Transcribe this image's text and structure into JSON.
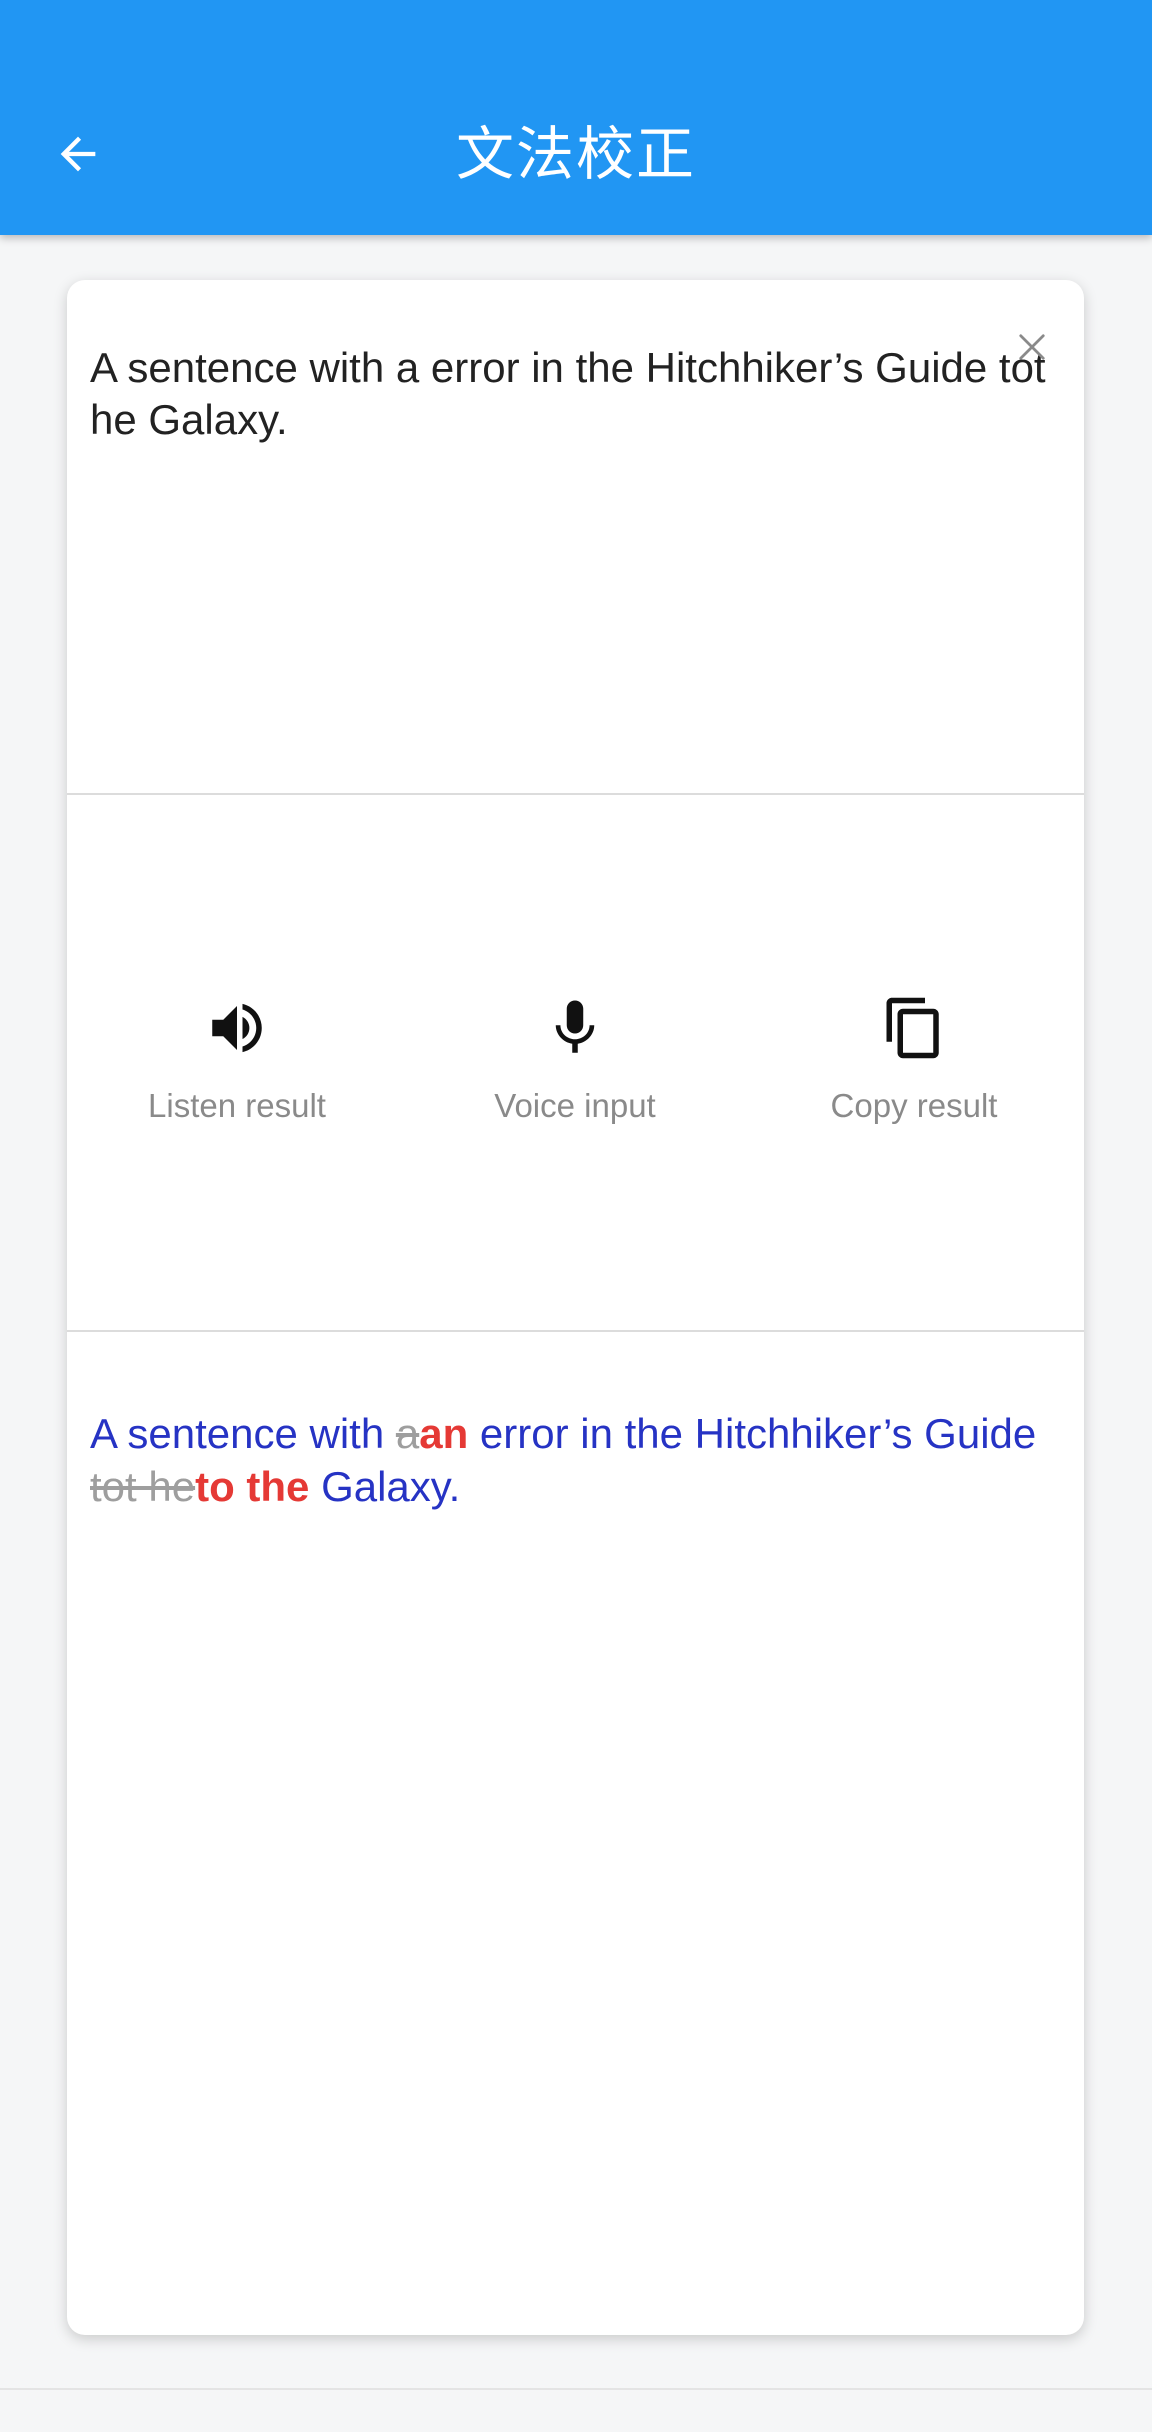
{
  "app_bar": {
    "title": "文法校正",
    "back_icon": "arrow-left-icon",
    "color": "#2196f3"
  },
  "input": {
    "text": "A sentence with a error in the Hitchhiker’s Guide tot he Galaxy.",
    "clear_icon": "close-icon"
  },
  "actions": [
    {
      "icon": "speaker-icon",
      "label": "Listen result"
    },
    {
      "icon": "microphone-icon",
      "label": "Voice input"
    },
    {
      "icon": "copy-icon",
      "label": "Copy result"
    }
  ],
  "result": {
    "segments": [
      {
        "type": "text",
        "text": "A sentence with "
      },
      {
        "type": "deleted",
        "text": "a"
      },
      {
        "type": "inserted",
        "text": "an"
      },
      {
        "type": "text",
        "text": " error in the Hitchhiker’s Guide "
      },
      {
        "type": "deleted",
        "text": "tot he"
      },
      {
        "type": "inserted",
        "text": "to the"
      },
      {
        "type": "text",
        "text": " Galaxy."
      }
    ],
    "text_color": "#2633c4",
    "inserted_color": "#e53935",
    "deleted_color": "#9e9e9e"
  }
}
